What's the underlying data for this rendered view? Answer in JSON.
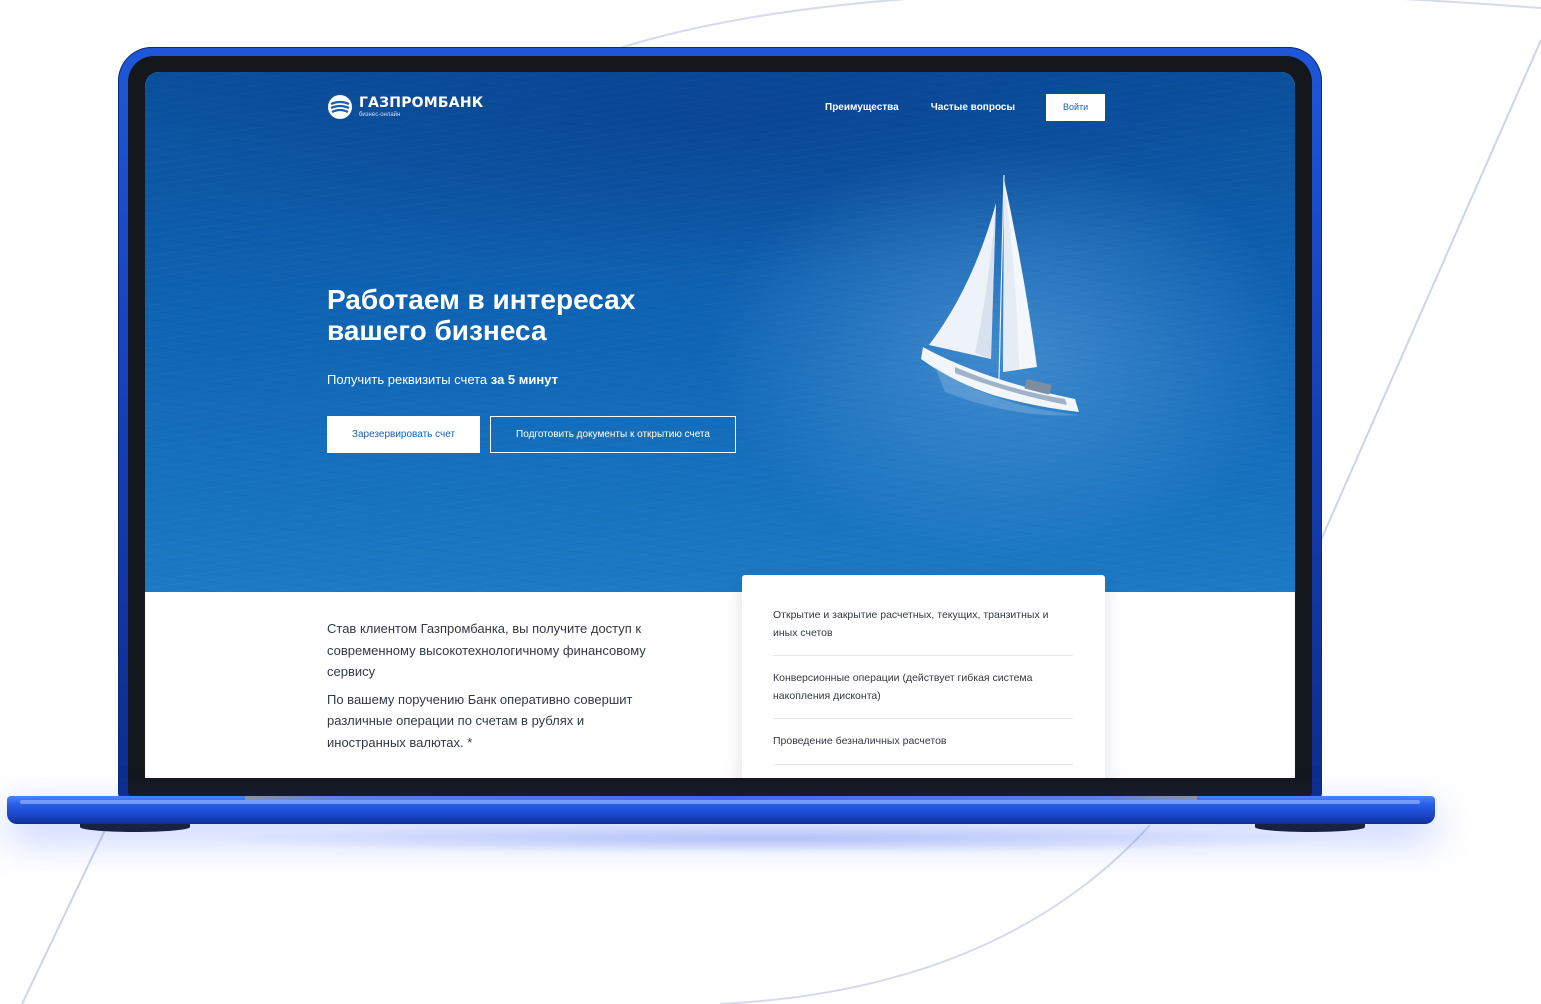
{
  "header": {
    "logo_name": "ГАЗПРОМБАНК",
    "logo_sub": "бизнес-онлайн",
    "nav": [
      {
        "label": "Преимущества"
      },
      {
        "label": "Частые вопросы"
      }
    ],
    "login_label": "Войти"
  },
  "hero": {
    "title_line1": "Работаем в интересах",
    "title_line2": "вашего бизнеса",
    "subtitle_prefix": "Получить реквизиты счета ",
    "subtitle_bold": "за 5 минут",
    "primary_button": "Зарезервировать счет",
    "secondary_button": "Подготовить документы к открытию счета"
  },
  "about": {
    "paragraph1": "Став клиентом Газпромбанка, вы получите доступ к современному высокотехнологичному финансовому сервису",
    "paragraph2": "По вашему поручению Банк оперативно совершит различные операции по счетам в рублях и иностранных валютах. *"
  },
  "services": {
    "items": [
      {
        "label": "Открытие и закрытие расчетных, текущих, транзитных и иных счетов"
      },
      {
        "label": "Конверсионные операции (действует гибкая система накопления дисконта)"
      },
      {
        "label": "Проведение безналичных расчетов"
      }
    ]
  },
  "colors": {
    "hero_blue": "#0f63b3",
    "laptop_blue": "#1f56d8",
    "button_text": "#1a5fb0",
    "body_text": "#333a45"
  },
  "icons": {
    "logo": "gazprombank-logo-icon"
  }
}
